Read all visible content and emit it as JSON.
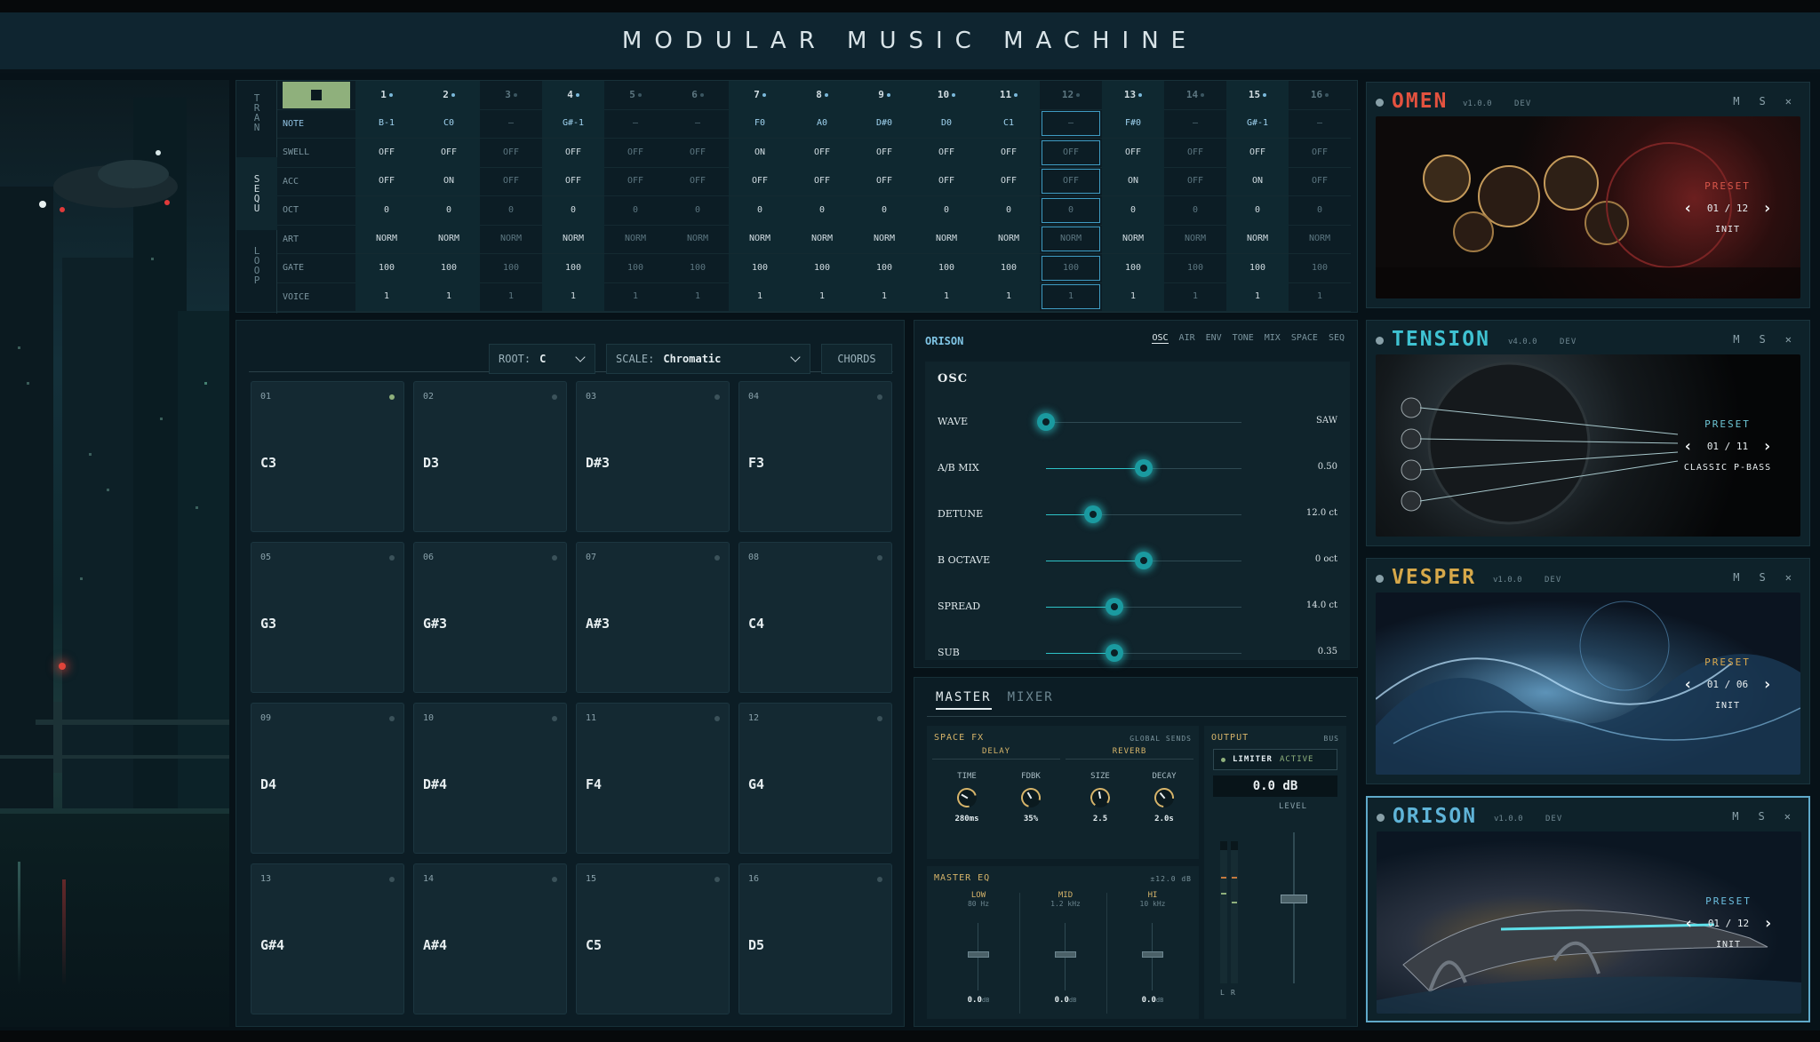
{
  "app": {
    "title": "MODULAR MUSIC MACHINE"
  },
  "sequencer": {
    "side_tabs": [
      "TRAN",
      "SEQU",
      "LOOP"
    ],
    "steps": [
      {
        "n": "1",
        "dot": true
      },
      {
        "n": "2",
        "dot": true
      },
      {
        "n": "3",
        "dot": false
      },
      {
        "n": "4",
        "dot": true
      },
      {
        "n": "5",
        "dot": false
      },
      {
        "n": "6",
        "dot": false
      },
      {
        "n": "7",
        "dot": true
      },
      {
        "n": "8",
        "dot": true
      },
      {
        "n": "9",
        "dot": true
      },
      {
        "n": "10",
        "dot": true
      },
      {
        "n": "11",
        "dot": true
      },
      {
        "n": "12",
        "dot": false
      },
      {
        "n": "13",
        "dot": true
      },
      {
        "n": "14",
        "dot": false
      },
      {
        "n": "15",
        "dot": true
      },
      {
        "n": "16",
        "dot": false
      }
    ],
    "rows": [
      {
        "label": "NOTE",
        "values": [
          "B-1",
          "C0",
          "—",
          "G#-1",
          "—",
          "—",
          "F0",
          "A0",
          "D#0",
          "D0",
          "C1",
          "—",
          "F#0",
          "—",
          "G#-1",
          "—"
        ]
      },
      {
        "label": "SWELL",
        "values": [
          "OFF",
          "OFF",
          "OFF",
          "OFF",
          "OFF",
          "OFF",
          "ON",
          "OFF",
          "OFF",
          "OFF",
          "OFF",
          "OFF",
          "OFF",
          "OFF",
          "OFF",
          "OFF"
        ]
      },
      {
        "label": "ACC",
        "values": [
          "OFF",
          "ON",
          "OFF",
          "OFF",
          "OFF",
          "OFF",
          "OFF",
          "OFF",
          "OFF",
          "OFF",
          "OFF",
          "OFF",
          "ON",
          "OFF",
          "ON",
          "OFF"
        ]
      },
      {
        "label": "OCT",
        "values": [
          "0",
          "0",
          "0",
          "0",
          "0",
          "0",
          "0",
          "0",
          "0",
          "0",
          "0",
          "0",
          "0",
          "0",
          "0",
          "0"
        ]
      },
      {
        "label": "ART",
        "values": [
          "NORM",
          "NORM",
          "NORM",
          "NORM",
          "NORM",
          "NORM",
          "NORM",
          "NORM",
          "NORM",
          "NORM",
          "NORM",
          "NORM",
          "NORM",
          "NORM",
          "NORM",
          "NORM"
        ]
      },
      {
        "label": "GATE",
        "values": [
          "100",
          "100",
          "100",
          "100",
          "100",
          "100",
          "100",
          "100",
          "100",
          "100",
          "100",
          "100",
          "100",
          "100",
          "100",
          "100"
        ]
      },
      {
        "label": "VOICE",
        "values": [
          "1",
          "1",
          "1",
          "1",
          "1",
          "1",
          "1",
          "1",
          "1",
          "1",
          "1",
          "1",
          "1",
          "1",
          "1",
          "1"
        ]
      }
    ]
  },
  "pads": {
    "root_label": "ROOT:",
    "root_value": "C",
    "scale_label": "SCALE:",
    "scale_value": "Chromatic",
    "chords_label": "CHORDS",
    "items": [
      {
        "num": "01",
        "note": "C3",
        "active": true
      },
      {
        "num": "02",
        "note": "D3"
      },
      {
        "num": "03",
        "note": "D#3"
      },
      {
        "num": "04",
        "note": "F3"
      },
      {
        "num": "05",
        "note": "G3"
      },
      {
        "num": "06",
        "note": "G#3"
      },
      {
        "num": "07",
        "note": "A#3"
      },
      {
        "num": "08",
        "note": "C4"
      },
      {
        "num": "09",
        "note": "D4"
      },
      {
        "num": "10",
        "note": "D#4"
      },
      {
        "num": "11",
        "note": "F4"
      },
      {
        "num": "12",
        "note": "G4"
      },
      {
        "num": "13",
        "note": "G#4"
      },
      {
        "num": "14",
        "note": "A#4"
      },
      {
        "num": "15",
        "note": "C5"
      },
      {
        "num": "16",
        "note": "D5"
      }
    ]
  },
  "synth": {
    "title": "ORISON",
    "tabs": [
      "OSC",
      "AIR",
      "ENV",
      "TONE",
      "MIX",
      "SPACE",
      "SEQ"
    ],
    "section": "OSC",
    "sliders": [
      {
        "label": "WAVE",
        "value": "SAW",
        "pos": 0.0
      },
      {
        "label": "A/B MIX",
        "value": "0.50",
        "pos": 0.5
      },
      {
        "label": "DETUNE",
        "value": "12.0 ct",
        "pos": 0.24
      },
      {
        "label": "B OCTAVE",
        "value": "0 oct",
        "pos": 0.5
      },
      {
        "label": "SPREAD",
        "value": "14.0 ct",
        "pos": 0.35
      },
      {
        "label": "SUB",
        "value": "0.35",
        "pos": 0.35
      }
    ]
  },
  "master": {
    "tabs": [
      "MASTER",
      "MIXER"
    ],
    "space_fx": "SPACE FX",
    "global_sends": "GLOBAL SENDS",
    "delay": "DELAY",
    "reverb": "REVERB",
    "knobs": [
      {
        "label": "TIME",
        "value": "280ms"
      },
      {
        "label": "FDBK",
        "value": "35%"
      },
      {
        "label": "SIZE",
        "value": "2.5"
      },
      {
        "label": "DECAY",
        "value": "2.0s"
      }
    ],
    "eq_title": "MASTER EQ",
    "eq_range": "±12.0 dB",
    "eq": [
      {
        "name": "LOW",
        "freq": "80 Hz",
        "value": "0.0",
        "unit": "dB"
      },
      {
        "name": "MID",
        "freq": "1.2 kHz",
        "value": "0.0",
        "unit": "dB"
      },
      {
        "name": "HI",
        "freq": "10 kHz",
        "value": "0.0",
        "unit": "dB"
      }
    ],
    "output": "OUTPUT",
    "bus": "BUS",
    "limiter": "LIMITER",
    "limiter_state": "ACTIVE",
    "output_db": "0.0 dB",
    "level": "LEVEL",
    "left": "L",
    "right": "R"
  },
  "instruments": [
    {
      "name": "OMEN",
      "version": "v1.0.0",
      "tag": "DEV",
      "color": "#e3523f",
      "preset_label": "PRESET",
      "preset": "01 / 12",
      "preset_name": "INIT",
      "m": "M",
      "s": "S",
      "x": "✕"
    },
    {
      "name": "TENSION",
      "version": "v4.0.0",
      "tag": "DEV",
      "color": "#3fc2d2",
      "preset_label": "PRESET",
      "preset": "01 / 11",
      "preset_name": "CLASSIC P-BASS",
      "m": "M",
      "s": "S",
      "x": "✕"
    },
    {
      "name": "VESPER",
      "version": "v1.0.0",
      "tag": "DEV",
      "color": "#d6a84a",
      "preset_label": "PRESET",
      "preset": "01 / 06",
      "preset_name": "INIT",
      "m": "M",
      "s": "S",
      "x": "✕"
    },
    {
      "name": "ORISON",
      "version": "v1.0.0",
      "tag": "DEV",
      "color": "#5fb4d8",
      "preset_label": "PRESET",
      "preset": "01 / 12",
      "preset_name": "INIT",
      "m": "M",
      "s": "S",
      "x": "✕",
      "selected": true
    }
  ]
}
